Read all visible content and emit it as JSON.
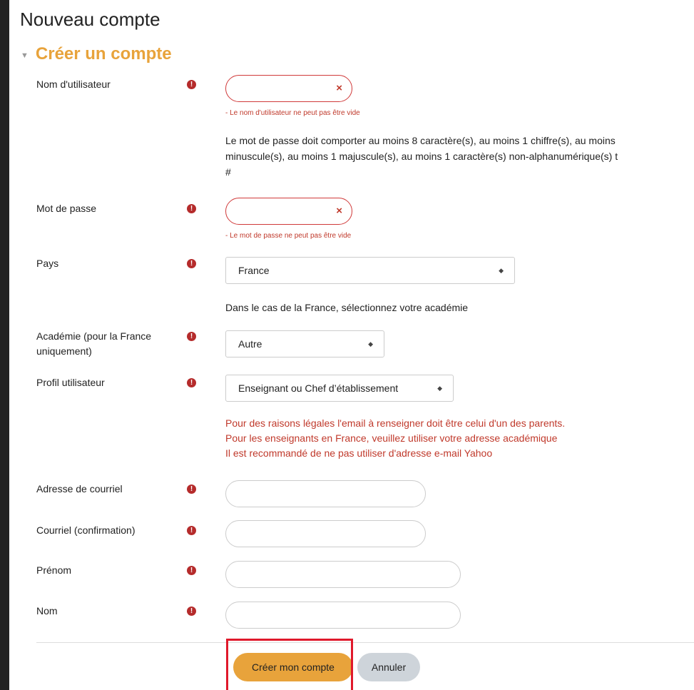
{
  "page": {
    "title": "Nouveau compte",
    "section_title": "Créer un compte"
  },
  "fields": {
    "username": {
      "label": "Nom d'utilisateur",
      "value": "",
      "error": "- Le nom d'utilisateur ne peut pas être vide"
    },
    "password_help_line1": "Le mot de passe doit comporter au moins 8 caractère(s), au moins 1 chiffre(s), au moins",
    "password_help_line2": "minuscule(s), au moins 1 majuscule(s), au moins 1 caractère(s) non-alphanumérique(s) t",
    "password_help_line3": "#",
    "password": {
      "label": "Mot de passe",
      "value": "",
      "error": "- Le mot de passe ne peut pas être vide"
    },
    "country": {
      "label": "Pays",
      "selected": "France"
    },
    "academy_help": "Dans le cas de la France, sélectionnez votre académie",
    "academy": {
      "label_line1": "Académie (pour la France",
      "label_line2": "uniquement)",
      "selected": "Autre"
    },
    "profile": {
      "label": "Profil utilisateur",
      "selected": "Enseignant ou Chef d’établissement"
    },
    "email_warnings": [
      "Pour des raisons légales l'email à renseigner doit être celui d'un des parents.",
      "Pour les enseignants en France, veuillez utiliser votre adresse académique",
      "Il est recommandé de ne pas utiliser d'adresse e-mail Yahoo"
    ],
    "email": {
      "label": "Adresse de courriel",
      "value": ""
    },
    "email_confirm": {
      "label": "Courriel (confirmation)",
      "value": ""
    },
    "firstname": {
      "label": "Prénom",
      "value": ""
    },
    "lastname": {
      "label": "Nom",
      "value": ""
    }
  },
  "icons": {
    "required": "!",
    "clear": "×",
    "collapse": "▼",
    "select_arrows": "◆"
  },
  "buttons": {
    "submit": "Créer mon compte",
    "cancel": "Annuler"
  },
  "colors": {
    "accent": "#e8a33b",
    "error": "#c0392b",
    "highlight": "#e0192b"
  }
}
